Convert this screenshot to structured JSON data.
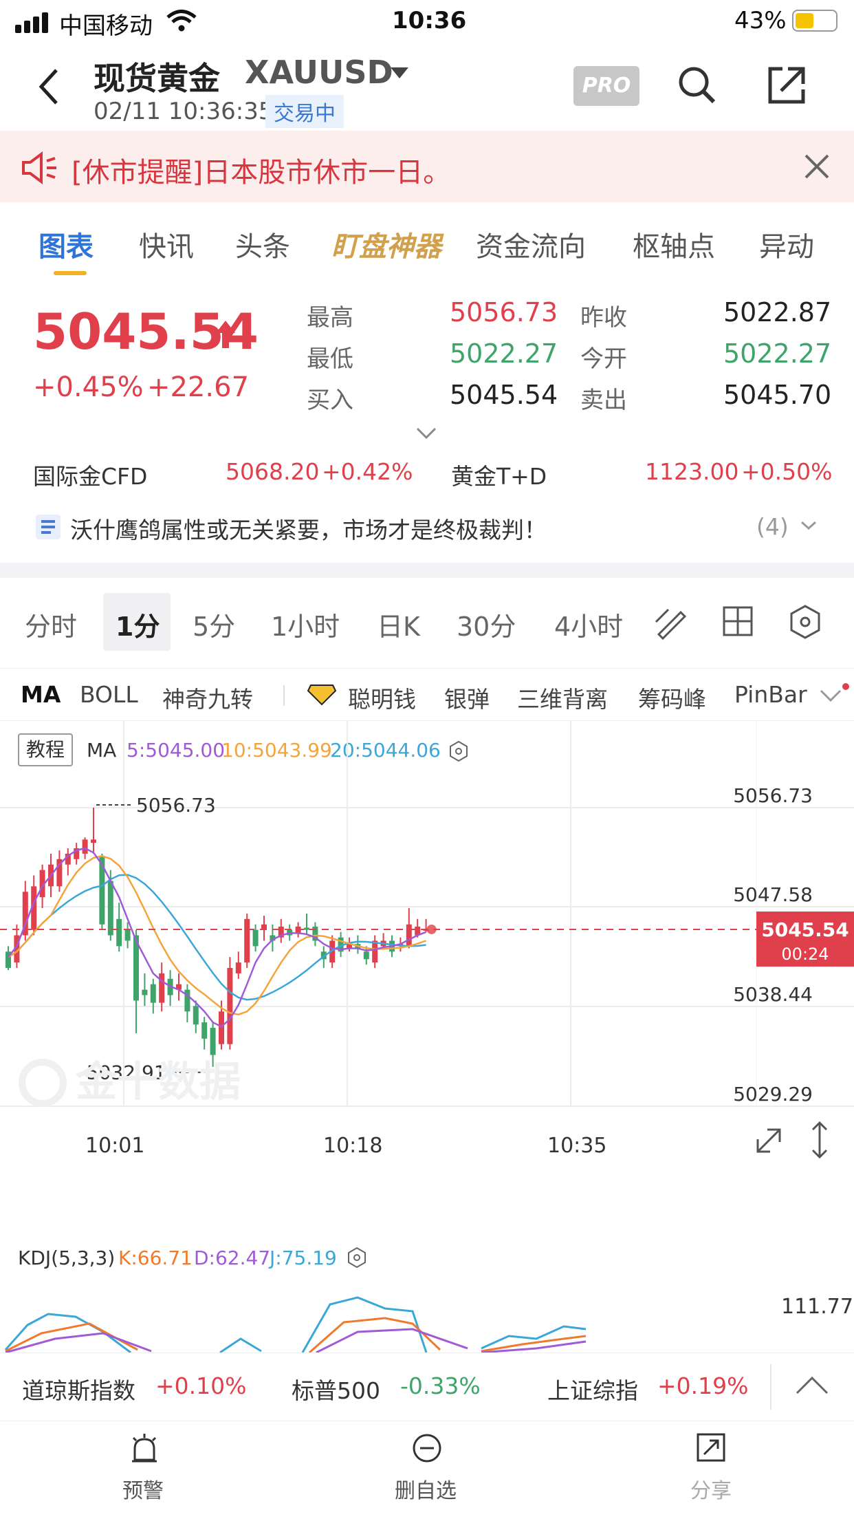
{
  "status_bar": {
    "carrier": "中国移动",
    "time": "10:36",
    "battery": "43%"
  },
  "header": {
    "title": "现货黄金",
    "symbol": "XAUUSD",
    "datetime": "02/11 10:36:35",
    "state": "交易中",
    "pro": "PRO"
  },
  "notice": {
    "text": "[休市提醒]日本股市休市一日。"
  },
  "tabs": [
    "图表",
    "快讯",
    "头条",
    "盯盘神器",
    "资金流向",
    "枢轴点",
    "异动"
  ],
  "quote": {
    "price": "5045.54",
    "pct": "+0.45%",
    "chg": "+22.67",
    "rows": [
      {
        "l1": "最高",
        "v1": "5056.73",
        "l2": "昨收",
        "v2": "5022.87"
      },
      {
        "l1": "最低",
        "v1": "5022.27",
        "l2": "今开",
        "v2": "5022.27"
      },
      {
        "l1": "买入",
        "v1": "5045.54",
        "l2": "卖出",
        "v2": "5045.70"
      }
    ]
  },
  "cfd": {
    "n1": "国际金CFD",
    "p1": "5068.20",
    "c1": "+0.42%",
    "n2": "黄金T+D",
    "p2": "1123.00",
    "c2": "+0.50%"
  },
  "news": {
    "text": "沃什鹰鸽属性或无关紧要，市场才是终极裁判！",
    "count": "(4)"
  },
  "periods": [
    "分时",
    "1分",
    "5分",
    "1小时",
    "日K",
    "30分",
    "4小时"
  ],
  "indicators": [
    "MA",
    "BOLL",
    "神奇九转",
    "聪明钱",
    "银弹",
    "三维背离",
    "筹码峰",
    "PinBar"
  ],
  "chart": {
    "tutorial": "教程",
    "ma_label": "MA",
    "ma5": "5:5045.00",
    "ma10": "10:5043.99",
    "ma20": "20:5044.06",
    "high_mark": "5056.73",
    "low_mark": "5032.91",
    "y_labels": [
      "5056.73",
      "5047.58",
      "5038.44",
      "5029.29"
    ],
    "price_tag": "5045.54",
    "countdown": "00:24",
    "x_labels": [
      "10:01",
      "10:18",
      "10:35"
    ],
    "watermark": "金十数据",
    "colors": {
      "up": "#e0404b",
      "down": "#3fa46a",
      "ma5": "#a05ad8",
      "ma10": "#f5a43c",
      "ma20": "#3aa7d8"
    }
  },
  "chart_data": {
    "type": "candlestick",
    "x": [
      "10:01",
      "10:18",
      "10:35"
    ],
    "ylim": [
      5029.29,
      5056.73
    ],
    "high": 5056.73,
    "low": 5032.91,
    "last": 5045.54,
    "ma": [
      {
        "name": "MA5",
        "value": 5045.0
      },
      {
        "name": "MA10",
        "value": 5043.99
      },
      {
        "name": "MA20",
        "value": 5044.06
      }
    ]
  },
  "kdj": {
    "label": "KDJ(5,3,3)",
    "k": "K:66.71",
    "d": "D:62.47",
    "j": "J:75.19",
    "y": "111.77"
  },
  "ticker": [
    {
      "name": "道琼斯指数",
      "val": "+0.10%",
      "up": true
    },
    {
      "name": "标普500",
      "val": "-0.33%",
      "up": false
    },
    {
      "name": "上证综指",
      "val": "+0.19%",
      "up": true
    }
  ],
  "bottom": [
    "预警",
    "删自选",
    "分享"
  ]
}
